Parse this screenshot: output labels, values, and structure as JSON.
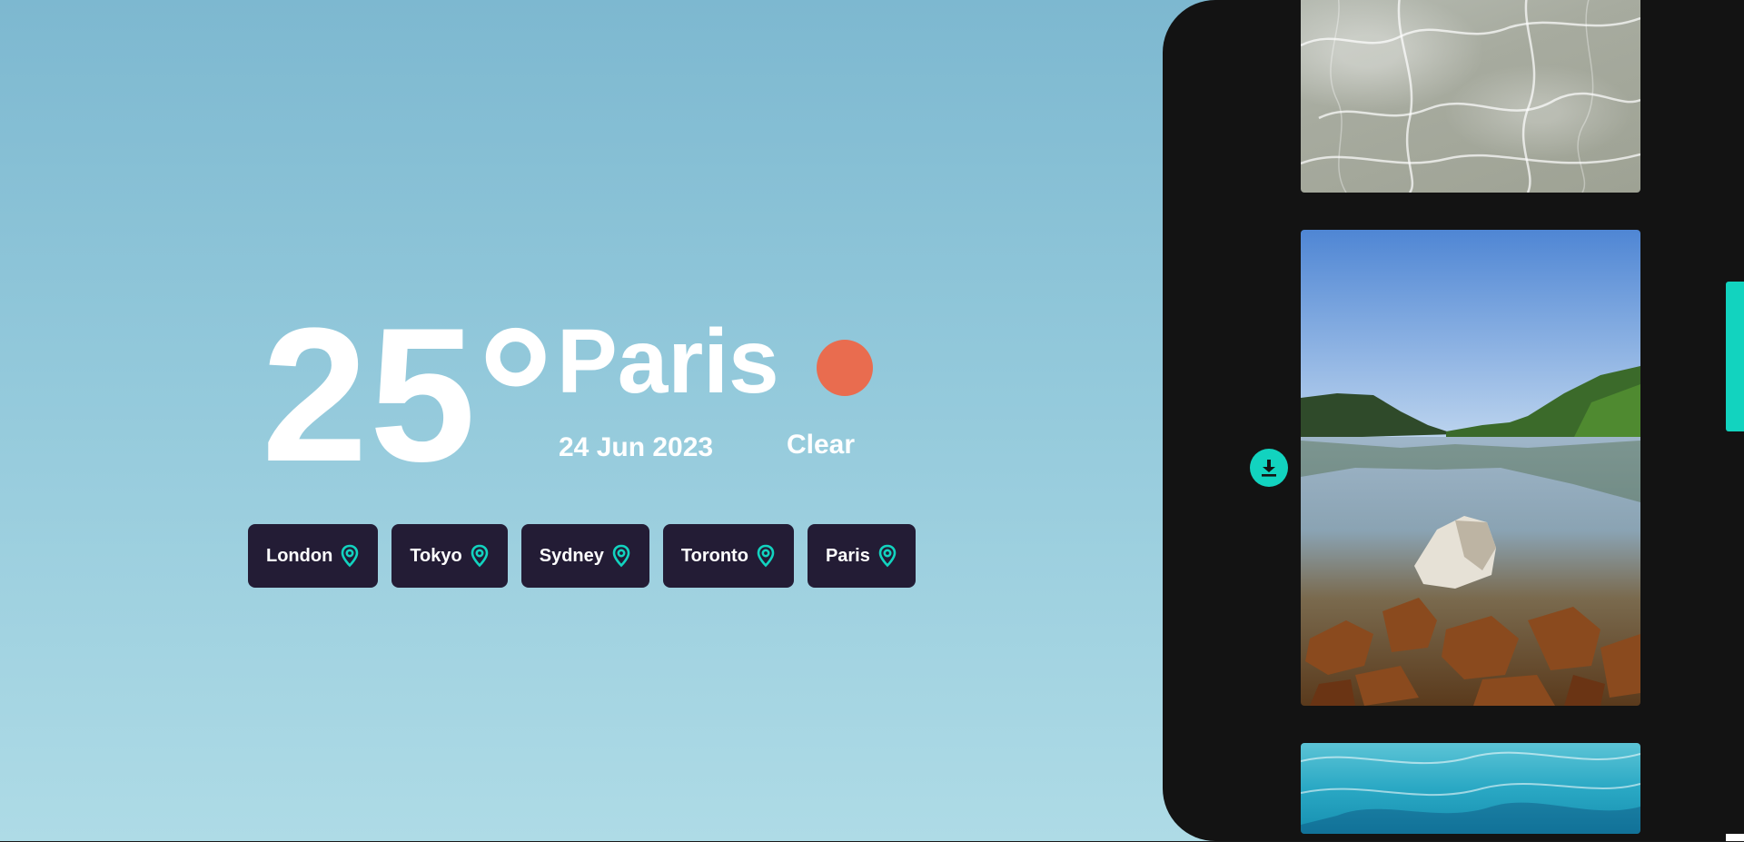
{
  "weather": {
    "temperature": "25°",
    "city": "Paris",
    "date": "24 Jun 2023",
    "condition": "Clear",
    "condition_icon": "sun-icon",
    "condition_color": "#e96c4f"
  },
  "locations": [
    {
      "label": "London",
      "icon": "location-pin-icon"
    },
    {
      "label": "Tokyo",
      "icon": "location-pin-icon"
    },
    {
      "label": "Sydney",
      "icon": "location-pin-icon"
    },
    {
      "label": "Toronto",
      "icon": "location-pin-icon"
    },
    {
      "label": "Paris",
      "icon": "location-pin-icon"
    }
  ],
  "gallery": {
    "download_icon": "download-icon",
    "images": [
      "water-caustics-photo",
      "mountain-lake-photo",
      "pool-water-photo"
    ]
  },
  "colors": {
    "accent": "#12d3bf",
    "chip_background": "#231c35",
    "panel_background": "#131313"
  }
}
